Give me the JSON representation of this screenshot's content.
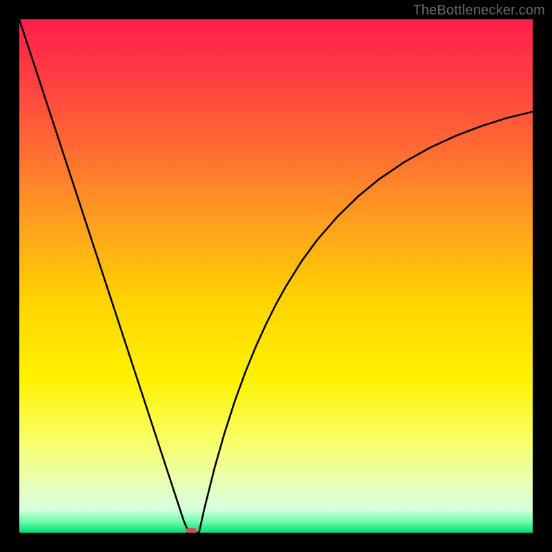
{
  "watermark": {
    "text": "TheBottlenecker.com"
  },
  "chart_data": {
    "type": "line",
    "title": "",
    "xlabel": "",
    "ylabel": "",
    "xlim": [
      0,
      100
    ],
    "ylim": [
      0,
      100
    ],
    "grid": false,
    "legend": false,
    "series": [
      {
        "name": "bottleneck-curve",
        "x": [
          0,
          2,
          4,
          6,
          8,
          10,
          12,
          14,
          16,
          18,
          20,
          22,
          24,
          26,
          28,
          30,
          31,
          32,
          33,
          34,
          35,
          36,
          38,
          40,
          42,
          44,
          46,
          48,
          50,
          52,
          55,
          58,
          62,
          66,
          70,
          75,
          80,
          85,
          90,
          95,
          100
        ],
        "y": [
          100,
          93.9,
          87.8,
          81.7,
          75.6,
          69.5,
          63.4,
          57.3,
          51.2,
          45.1,
          39.0,
          32.9,
          26.8,
          20.7,
          14.6,
          8.5,
          5.45,
          2.4,
          0.0,
          0.0,
          0.0,
          4.5,
          12.5,
          19.5,
          25.7,
          31.2,
          36.1,
          40.5,
          44.5,
          48.1,
          52.9,
          57.0,
          61.6,
          65.5,
          68.8,
          72.2,
          75.0,
          77.3,
          79.2,
          80.8,
          82.0
        ]
      }
    ],
    "gradient_stops": [
      {
        "offset": 0.0,
        "color": "#ff1f4b"
      },
      {
        "offset": 0.1,
        "color": "#ff3a44"
      },
      {
        "offset": 0.25,
        "color": "#ff6a34"
      },
      {
        "offset": 0.4,
        "color": "#ffa11e"
      },
      {
        "offset": 0.55,
        "color": "#ffd400"
      },
      {
        "offset": 0.7,
        "color": "#fff200"
      },
      {
        "offset": 0.82,
        "color": "#f8ff66"
      },
      {
        "offset": 0.9,
        "color": "#e8ffb3"
      },
      {
        "offset": 0.955,
        "color": "#d8ffe0"
      },
      {
        "offset": 0.975,
        "color": "#7dffb0"
      },
      {
        "offset": 1.0,
        "color": "#00e07a"
      }
    ],
    "marker": {
      "x": 33.5,
      "y": 0.0,
      "color": "#c05a50"
    }
  }
}
